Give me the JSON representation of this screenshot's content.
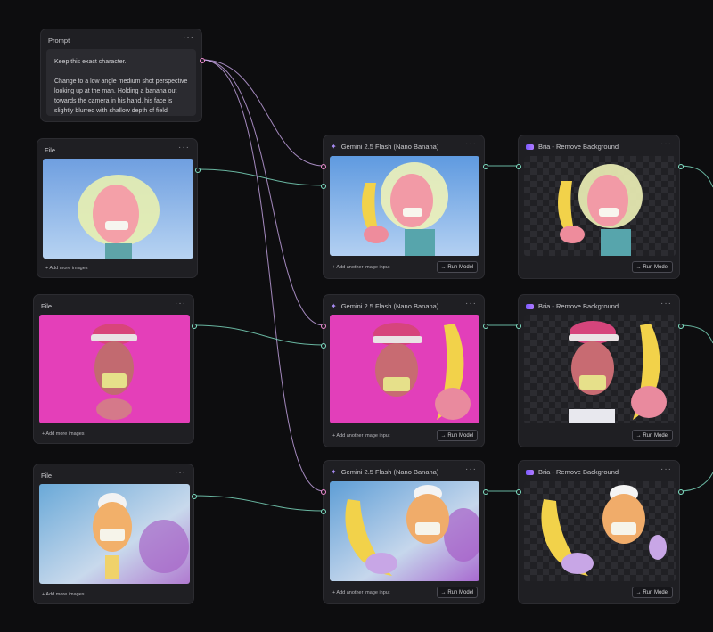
{
  "prompt_node": {
    "title": "Prompt",
    "menu": "···",
    "lines": [
      "Keep this exact character.",
      "Change to a low angle medium shot perspective looking up at the man. Holding a banana out towards the camera in his hand. his face is slightly blurred with shallow depth of field"
    ]
  },
  "file_nodes": [
    {
      "title": "File",
      "menu": "···",
      "add_label": "+ Add more images"
    },
    {
      "title": "File",
      "menu": "···",
      "add_label": "+ Add more images"
    },
    {
      "title": "File",
      "menu": "···",
      "add_label": "+ Add more images"
    }
  ],
  "gemini_nodes": [
    {
      "title": "Gemini 2.5 Flash (Nano Banana)",
      "menu": "···",
      "add_label": "+ Add another image input",
      "run_label": "→ Run Model"
    },
    {
      "title": "Gemini 2.5 Flash (Nano Banana)",
      "menu": "···",
      "add_label": "+ Add another image input",
      "run_label": "→ Run Model"
    },
    {
      "title": "Gemini 2.5 Flash (Nano Banana)",
      "menu": "···",
      "add_label": "+ Add another image input",
      "run_label": "→ Run Model"
    }
  ],
  "bria_nodes": [
    {
      "title": "Bria - Remove Background",
      "menu": "···",
      "run_label": "→ Run Model"
    },
    {
      "title": "Bria - Remove Background",
      "menu": "···",
      "run_label": "→ Run Model"
    },
    {
      "title": "Bria - Remove Background",
      "menu": "···",
      "run_label": "→ Run Model"
    }
  ],
  "colors": {
    "canvas": "#0d0d0f",
    "node": "#1f1f23",
    "port_image": "#7fe0c4",
    "port_text": "#f08cd2",
    "accent": "#a98cf5"
  },
  "icons": {
    "gemini": "sparkle-icon",
    "bria": "bria-logo-icon",
    "menu": "more-horizontal-icon"
  }
}
